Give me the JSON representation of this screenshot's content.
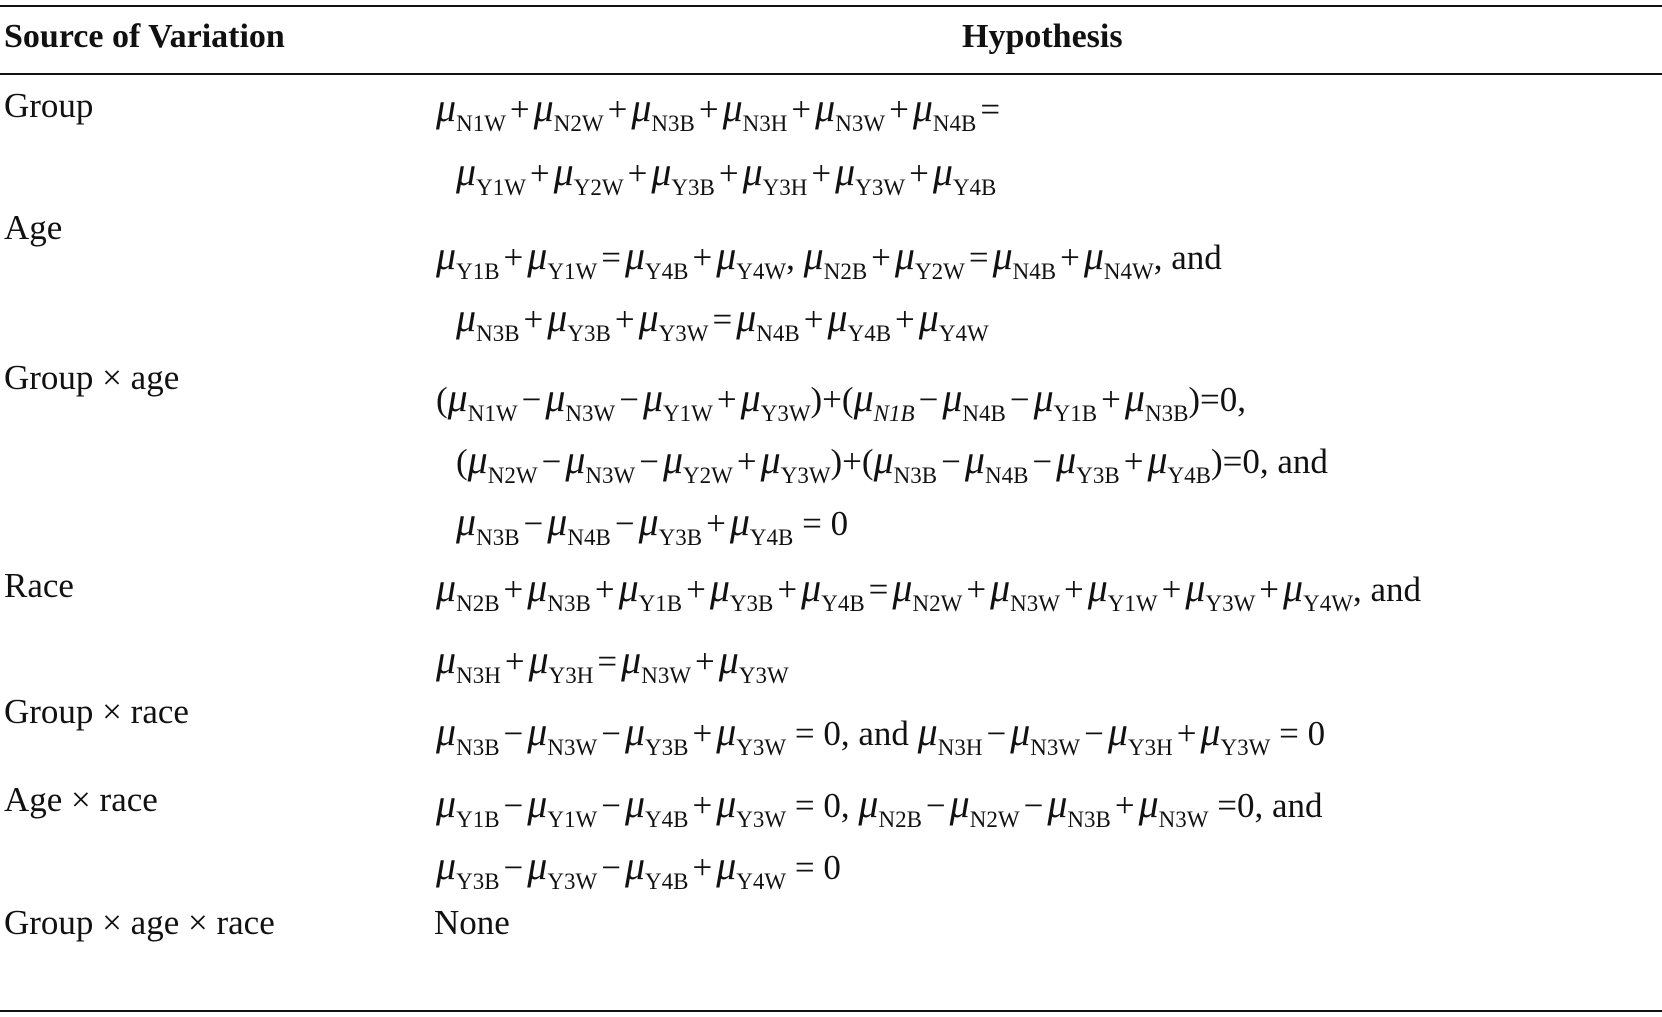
{
  "table": {
    "headers": {
      "source": "Source of Variation",
      "hypothesis": "Hypothesis"
    },
    "rows": [
      {
        "source": "Group",
        "lines": [
          [
            {
              "s": "N1W"
            },
            {
              "o": "+"
            },
            {
              "s": "N2W"
            },
            {
              "o": "+"
            },
            {
              "s": "N3B"
            },
            {
              "o": "+"
            },
            {
              "s": "N3H"
            },
            {
              "o": "+"
            },
            {
              "s": "N3W"
            },
            {
              "o": "+"
            },
            {
              "s": "N4B"
            },
            {
              "o": "="
            }
          ],
          [
            {
              "s": "Y1W"
            },
            {
              "o": "+"
            },
            {
              "s": "Y2W"
            },
            {
              "o": "+"
            },
            {
              "s": "Y3B"
            },
            {
              "o": "+"
            },
            {
              "s": "Y3H"
            },
            {
              "o": "+"
            },
            {
              "s": "Y3W"
            },
            {
              "o": "+"
            },
            {
              "s": "Y4B"
            }
          ]
        ]
      },
      {
        "source": "Age",
        "lines": [
          [
            {
              "s": "Y1B"
            },
            {
              "o": "+"
            },
            {
              "s": "Y1W"
            },
            {
              "o": "="
            },
            {
              "s": "Y4B"
            },
            {
              "o": "+"
            },
            {
              "s": "Y4W"
            },
            {
              "t": ", "
            },
            {
              "s": "N2B"
            },
            {
              "o": "+"
            },
            {
              "s": "Y2W"
            },
            {
              "o": "="
            },
            {
              "s": "N4B"
            },
            {
              "o": "+"
            },
            {
              "s": "N4W"
            },
            {
              "t": ", and"
            }
          ],
          [
            {
              "s": "N3B"
            },
            {
              "o": "+"
            },
            {
              "s": "Y3B"
            },
            {
              "o": "+"
            },
            {
              "s": "Y3W"
            },
            {
              "o": "="
            },
            {
              "s": "N4B"
            },
            {
              "o": "+"
            },
            {
              "s": "Y4B"
            },
            {
              "o": "+"
            },
            {
              "s": "Y4W"
            }
          ]
        ]
      },
      {
        "source": "Group × age",
        "lines": [
          [
            {
              "t": "("
            },
            {
              "s": "N1W"
            },
            {
              "o": "−"
            },
            {
              "s": "N3W"
            },
            {
              "o": "−"
            },
            {
              "s": "Y1W"
            },
            {
              "o": "+"
            },
            {
              "s": "Y3W"
            },
            {
              "t": ")+("
            },
            {
              "s": "N1B",
              "i": true
            },
            {
              "o": "−"
            },
            {
              "s": "N4B"
            },
            {
              "o": "−"
            },
            {
              "s": "Y1B"
            },
            {
              "o": "+"
            },
            {
              "s": "N3B"
            },
            {
              "t": ")=0,"
            }
          ],
          [
            {
              "t": "("
            },
            {
              "s": "N2W"
            },
            {
              "o": "−"
            },
            {
              "s": "N3W"
            },
            {
              "o": "−"
            },
            {
              "s": "Y2W"
            },
            {
              "o": "+"
            },
            {
              "s": "Y3W"
            },
            {
              "t": ")+("
            },
            {
              "s": "N3B"
            },
            {
              "o": "−"
            },
            {
              "s": "N4B"
            },
            {
              "o": "−"
            },
            {
              "s": "Y3B"
            },
            {
              "o": "+"
            },
            {
              "s": "Y4B"
            },
            {
              "t": ")=0, and"
            }
          ],
          [
            {
              "s": "N3B"
            },
            {
              "o": "−"
            },
            {
              "s": "N4B"
            },
            {
              "o": "−"
            },
            {
              "s": "Y3B"
            },
            {
              "o": "+"
            },
            {
              "s": "Y4B"
            },
            {
              "t": " = 0"
            }
          ]
        ]
      },
      {
        "source": "Race",
        "lines": [
          [
            {
              "s": "N2B"
            },
            {
              "o": "+"
            },
            {
              "s": "N3B"
            },
            {
              "o": "+"
            },
            {
              "s": "Y1B"
            },
            {
              "o": "+"
            },
            {
              "s": "Y3B"
            },
            {
              "o": "+"
            },
            {
              "s": "Y4B"
            },
            {
              "o": "="
            },
            {
              "s": "N2W"
            },
            {
              "o": "+"
            },
            {
              "s": "N3W"
            },
            {
              "o": "+"
            },
            {
              "s": "Y1W"
            },
            {
              "o": "+"
            },
            {
              "s": "Y3W"
            },
            {
              "o": "+"
            },
            {
              "s": "Y4W"
            },
            {
              "t": ",  and"
            }
          ],
          [
            {
              "s": "N3H"
            },
            {
              "o": "+"
            },
            {
              "s": "Y3H"
            },
            {
              "o": "="
            },
            {
              "s": "N3W"
            },
            {
              "o": "+"
            },
            {
              "s": "Y3W"
            }
          ]
        ]
      },
      {
        "source": "Group × race",
        "lines": [
          [
            {
              "s": "N3B"
            },
            {
              "o": "−"
            },
            {
              "s": "N3W"
            },
            {
              "o": "−"
            },
            {
              "s": "Y3B"
            },
            {
              "o": "+"
            },
            {
              "s": "Y3W"
            },
            {
              "t": " = 0, and "
            },
            {
              "s": "N3H"
            },
            {
              "o": "−"
            },
            {
              "s": "N3W"
            },
            {
              "o": "−"
            },
            {
              "s": "Y3H"
            },
            {
              "o": "+"
            },
            {
              "s": "Y3W"
            },
            {
              "t": " = 0"
            }
          ]
        ]
      },
      {
        "source": "Age × race",
        "lines": [
          [
            {
              "s": "Y1B"
            },
            {
              "o": "−"
            },
            {
              "s": "Y1W"
            },
            {
              "o": "−"
            },
            {
              "s": "Y4B"
            },
            {
              "o": "+"
            },
            {
              "s": "Y3W"
            },
            {
              "t": " = 0, "
            },
            {
              "s": "N2B"
            },
            {
              "o": "−"
            },
            {
              "s": "N2W"
            },
            {
              "o": "−"
            },
            {
              "s": "N3B"
            },
            {
              "o": "+"
            },
            {
              "s": "N3W"
            },
            {
              "t": " =0, and"
            }
          ],
          [
            {
              "s": "Y3B"
            },
            {
              "o": "−"
            },
            {
              "s": "Y3W"
            },
            {
              "o": "−"
            },
            {
              "s": "Y4B"
            },
            {
              "o": "+"
            },
            {
              "s": "Y4W"
            },
            {
              "t": " = 0"
            }
          ]
        ]
      },
      {
        "source": "Group × age × race",
        "lines": [
          [
            {
              "t": "None"
            }
          ]
        ]
      }
    ]
  }
}
